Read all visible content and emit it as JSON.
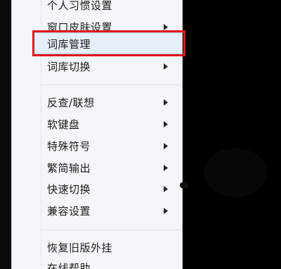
{
  "menu": {
    "items": [
      {
        "label": "个人习惯设置",
        "submenu": false
      },
      {
        "label": "窗口皮肤设置",
        "submenu": true
      },
      {
        "label": "词库管理",
        "submenu": false,
        "highlighted": true
      },
      {
        "label": "词库切换",
        "submenu": true
      },
      {
        "label": "反查/联想",
        "submenu": true
      },
      {
        "label": "软键盘",
        "submenu": true
      },
      {
        "label": "特殊符号",
        "submenu": true
      },
      {
        "label": "繁简输出",
        "submenu": true
      },
      {
        "label": "快速切换",
        "submenu": true
      },
      {
        "label": "兼容设置",
        "submenu": true
      },
      {
        "label": "恢复旧版外挂",
        "submenu": false
      },
      {
        "label": "在线帮助",
        "submenu": false
      }
    ]
  },
  "annotation": {
    "highlight_color": "#e0151b"
  },
  "colors": {
    "menu_background": "#f5f6f8",
    "screen_background": "#000000",
    "hover_background": "#e6eef9"
  }
}
